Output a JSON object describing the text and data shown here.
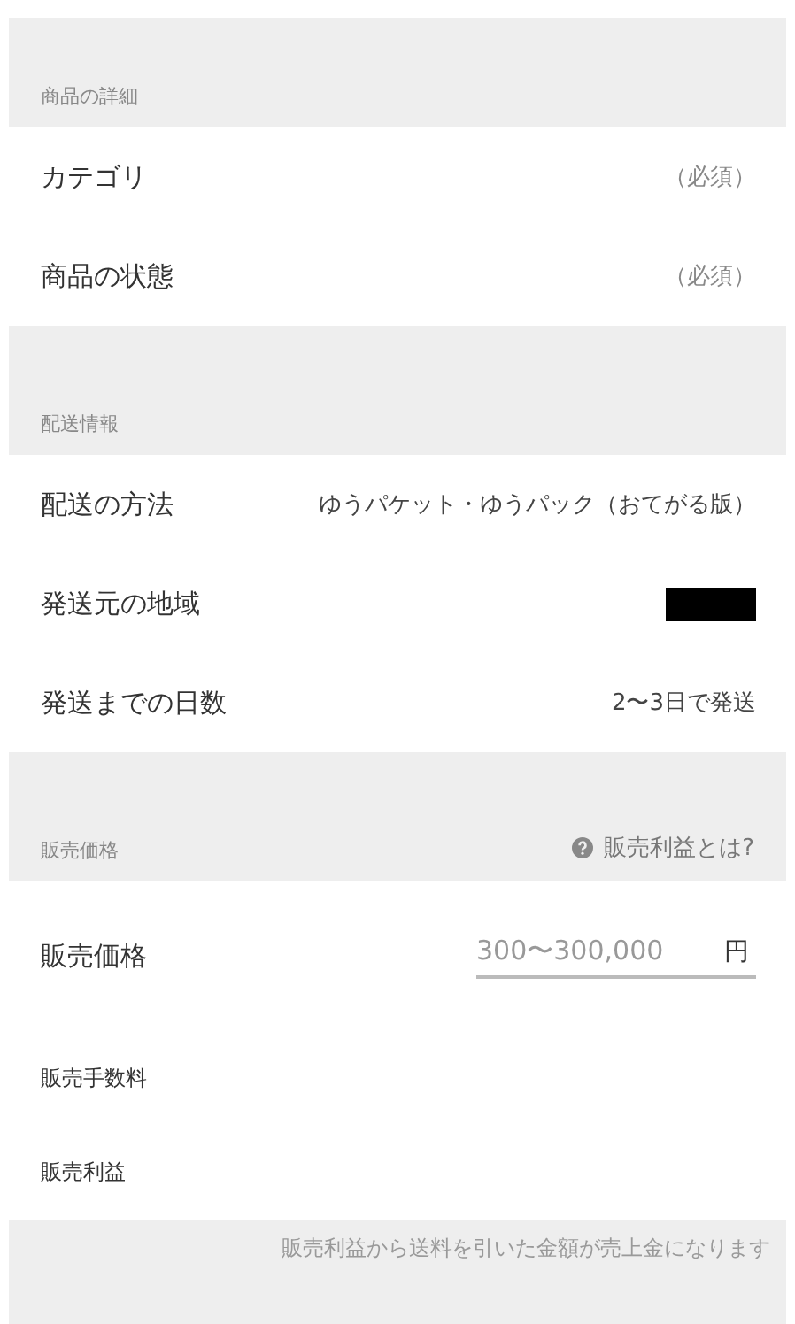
{
  "sections": [
    {
      "title": "商品の詳細",
      "rows": [
        {
          "kind": "text",
          "label": "カテゴリ",
          "value": "（必須）",
          "muted": true
        },
        {
          "kind": "text",
          "label": "商品の状態",
          "value": "（必須）",
          "muted": true
        }
      ]
    },
    {
      "title": "配送情報",
      "rows": [
        {
          "kind": "text",
          "label": "配送の方法",
          "value": "ゆうパケット・ゆうパック（おてがる版）",
          "muted": false
        },
        {
          "kind": "redacted",
          "label": "発送元の地域"
        },
        {
          "kind": "text",
          "label": "発送までの日数",
          "value": "2〜3日で発送",
          "muted": false
        }
      ]
    },
    {
      "title": "販売価格",
      "help": "販売利益とは?",
      "rows": [
        {
          "kind": "price",
          "label": "販売価格",
          "placeholder": "300〜300,000",
          "unit": "円"
        },
        {
          "kind": "small",
          "label": "販売手数料"
        },
        {
          "kind": "small",
          "label": "販売利益"
        }
      ]
    }
  ],
  "footer_note": "販売利益から送料を引いた金額が売上金になります"
}
